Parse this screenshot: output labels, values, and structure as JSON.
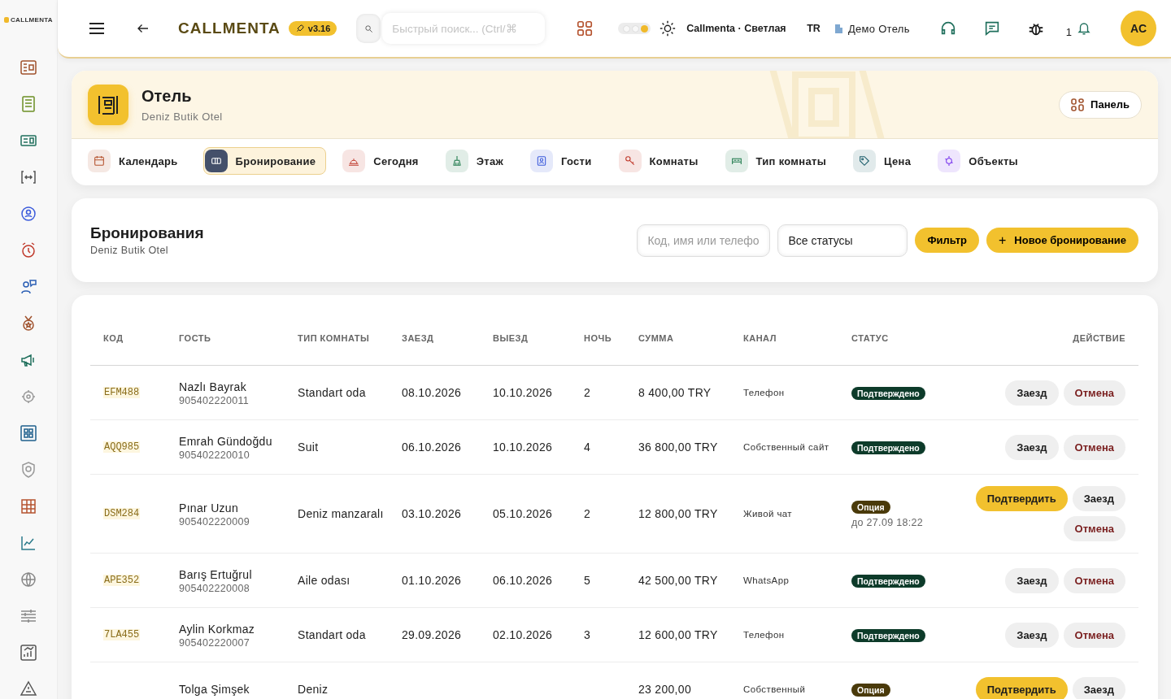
{
  "sidebar": {
    "logo": "CALLMENTA"
  },
  "topbar": {
    "brand": "CALLMENTA",
    "version": "v3.16",
    "search": {
      "placeholder": "Быстрый поиск... (Ctrl/⌘"
    },
    "theme_toggle": {
      "on": true
    },
    "theme": "Callmenta · Светлая",
    "language": "TR",
    "hotel": "Демо Отель",
    "notifications": "1",
    "avatar": "AC"
  },
  "module": {
    "title": "Отель",
    "subtitle": "Deniz Butik Otel",
    "panel_button": "Панель",
    "tabs": [
      {
        "label": "Календарь",
        "selected": false
      },
      {
        "label": "Бронирование",
        "selected": true
      },
      {
        "label": "Сегодня",
        "selected": false
      },
      {
        "label": "Этаж",
        "selected": false
      },
      {
        "label": "Гости",
        "selected": false
      },
      {
        "label": "Комнаты",
        "selected": false
      },
      {
        "label": "Тип комнаты",
        "selected": false
      },
      {
        "label": "Цена",
        "selected": false
      },
      {
        "label": "Объекты",
        "selected": false
      }
    ]
  },
  "bookings_header": {
    "title": "Бронирования",
    "subtitle": "Deniz Butik Otel",
    "search": {
      "placeholder": "Код, имя или телефо"
    },
    "status_select": "Все статусы",
    "filter_button": "Фильтр",
    "new_button": "+",
    "new_button_label": "Новое бронирование"
  },
  "table": {
    "columns": [
      "КОД",
      "ГОСТЬ",
      "ТИП КОМНАТЫ",
      "ЗАЕЗД",
      "ВЫЕЗД",
      "НОЧЬ",
      "СУММА",
      "КАНАЛ",
      "СТАТУС",
      "ДЕЙСТВИЕ"
    ],
    "rows": [
      {
        "code": "EFM488",
        "guest": "Nazlı Bayrak",
        "phone": "905402220011",
        "room_type": "Standart oda",
        "check_in": "08.10.2026",
        "check_out": "10.10.2026",
        "nights": "2",
        "amount": "8 400,00 TRY",
        "channel": "Телефон",
        "status": {
          "kind": "confirmed",
          "label": "Подтверждено"
        },
        "actions": [
          {
            "kind": "checkin",
            "label": "Заезд"
          },
          {
            "kind": "cancel",
            "label": "Отмена"
          }
        ]
      },
      {
        "code": "AQQ985",
        "guest": "Emrah Gündoğdu",
        "phone": "905402220010",
        "room_type": "Suit",
        "check_in": "06.10.2026",
        "check_out": "10.10.2026",
        "nights": "4",
        "amount": "36 800,00 TRY",
        "channel": "Собственный сайт",
        "status": {
          "kind": "confirmed",
          "label": "Подтверждено"
        },
        "actions": [
          {
            "kind": "checkin",
            "label": "Заезд"
          },
          {
            "kind": "cancel",
            "label": "Отмена"
          }
        ]
      },
      {
        "code": "DSM284",
        "guest": "Pınar Uzun",
        "phone": "905402220009",
        "room_type": "Deniz manzaralı",
        "check_in": "03.10.2026",
        "check_out": "05.10.2026",
        "nights": "2",
        "amount": "12 800,00 TRY",
        "channel": "Живой чат",
        "status": {
          "kind": "option",
          "label": "Опция",
          "note": "до 27.09 18:22"
        },
        "actions": [
          {
            "kind": "confirm",
            "label": "Подтвердить"
          },
          {
            "kind": "checkin",
            "label": "Заезд"
          },
          {
            "kind": "cancel",
            "label": "Отмена"
          }
        ]
      },
      {
        "code": "APE352",
        "guest": "Barış Ertuğrul",
        "phone": "905402220008",
        "room_type": "Aile odası",
        "check_in": "01.10.2026",
        "check_out": "06.10.2026",
        "nights": "5",
        "amount": "42 500,00 TRY",
        "channel": "WhatsApp",
        "status": {
          "kind": "confirmed",
          "label": "Подтверждено"
        },
        "actions": [
          {
            "kind": "checkin",
            "label": "Заезд"
          },
          {
            "kind": "cancel",
            "label": "Отмена"
          }
        ]
      },
      {
        "code": "7LA455",
        "guest": "Aylin Korkmaz",
        "phone": "905402220007",
        "room_type": "Standart oda",
        "check_in": "29.09.2026",
        "check_out": "02.10.2026",
        "nights": "3",
        "amount": "12 600,00 TRY",
        "channel": "Телефон",
        "status": {
          "kind": "confirmed",
          "label": "Подтверждено"
        },
        "actions": [
          {
            "kind": "checkin",
            "label": "Заезд"
          },
          {
            "kind": "cancel",
            "label": "Отмена"
          }
        ]
      },
      {
        "guest": "Tolga Şimşek",
        "room_type": "Deniz",
        "amount": "23 200,00",
        "channel": "Собственный",
        "status": {
          "kind": "option",
          "label": "Опция"
        },
        "actions": [
          {
            "kind": "confirm",
            "label": "Подтвердить"
          },
          {
            "kind": "checkin",
            "label": "Заезд"
          }
        ]
      }
    ]
  }
}
